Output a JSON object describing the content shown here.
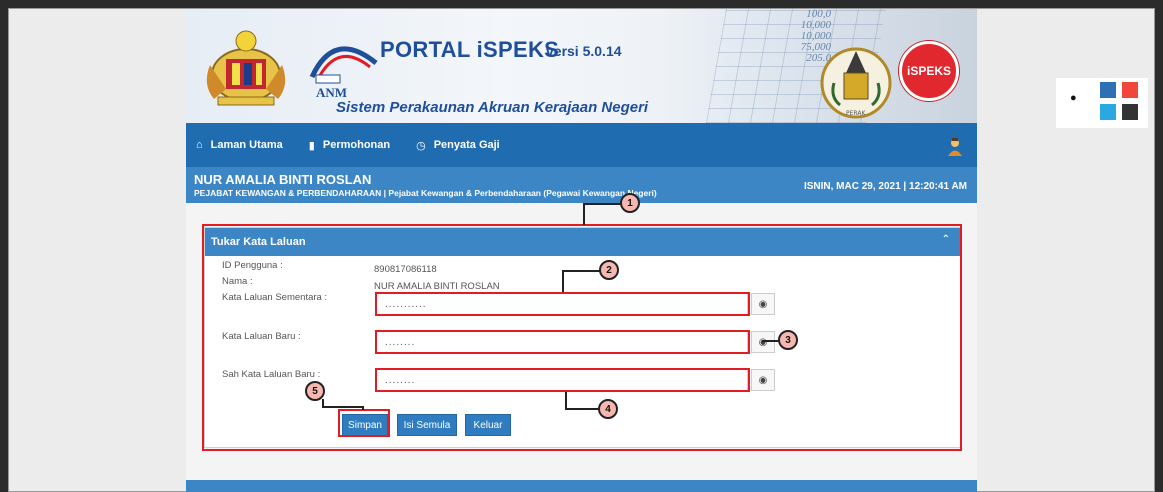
{
  "header": {
    "title": "PORTAL iSPEKS",
    "version": "versi 5.0.14",
    "subtitle": "Sistem Perakaunan Akruan Kerajaan Negeri",
    "anm_logo_text": "ANM",
    "perak_logo_text": "PERAK",
    "ispeks_badge": "iSPEKS",
    "banner_numbers": [
      "100,0",
      "10,000",
      "10,000",
      "75,000",
      "205.0"
    ]
  },
  "nav": {
    "items": [
      {
        "label": "Laman Utama",
        "icon": "home-icon"
      },
      {
        "label": "Permohonan",
        "icon": "book-icon"
      },
      {
        "label": "Penyata Gaji",
        "icon": "clock-icon"
      }
    ]
  },
  "user": {
    "name": "NUR AMALIA BINTI ROSLAN",
    "department": "PEJABAT KEWANGAN & PERBENDAHARAAN | Pejabat Kewangan & Perbendaharaan (Pegawai Kewangan Negeri)",
    "datetime": "ISNIN, MAC 29, 2021 | 12:20:41 AM"
  },
  "form": {
    "panel_title": "Tukar Kata Laluan",
    "id_label": "ID Pengguna :",
    "id_value": "890817086118",
    "name_label": "Nama :",
    "name_value": "NUR AMALIA BINTI ROSLAN",
    "temp_password_label": "Kata Laluan Sementara :",
    "temp_password_value": "...........",
    "new_password_label": "Kata Laluan Baru :",
    "new_password_value": "........",
    "confirm_password_label": "Sah Kata Laluan Baru :",
    "confirm_password_value": "........",
    "buttons": {
      "save": "Simpan",
      "reset": "Isi Semula",
      "exit": "Keluar"
    }
  },
  "callouts": [
    "1",
    "2",
    "3",
    "4",
    "5"
  ],
  "colors": {
    "nav_blue": "#1f6cb1",
    "panel_blue": "#3d86c6",
    "annotation_red": "#e31b23",
    "button_blue": "#2f7dc0"
  },
  "theme_swatches": [
    "#2f6fb3",
    "#f0463c",
    "#2aa9e0",
    "#333333"
  ]
}
